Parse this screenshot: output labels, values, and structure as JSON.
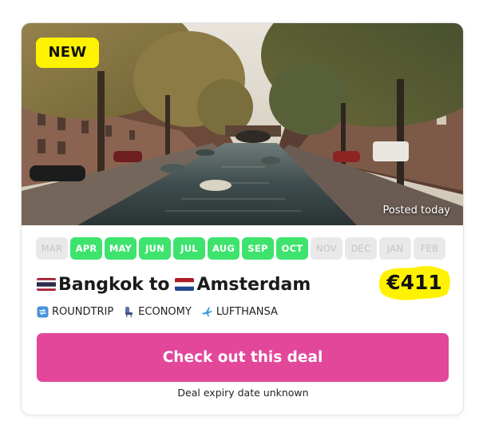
{
  "deal": {
    "badge": "NEW",
    "posted": "Posted today",
    "months": [
      {
        "label": "MAR",
        "active": false
      },
      {
        "label": "APR",
        "active": true
      },
      {
        "label": "MAY",
        "active": true
      },
      {
        "label": "JUN",
        "active": true
      },
      {
        "label": "JUL",
        "active": true
      },
      {
        "label": "AUG",
        "active": true
      },
      {
        "label": "SEP",
        "active": true
      },
      {
        "label": "OCT",
        "active": true
      },
      {
        "label": "NOV",
        "active": false
      },
      {
        "label": "DEC",
        "active": false
      },
      {
        "label": "JAN",
        "active": false
      },
      {
        "label": "FEB",
        "active": false
      }
    ],
    "origin": "Bangkok",
    "connector": "to",
    "destination": "Amsterdam",
    "origin_flag": "thailand-flag",
    "destination_flag": "netherlands-flag",
    "price": "€411",
    "tags": {
      "trip_type": "ROUNDTRIP",
      "cabin": "ECONOMY",
      "airline": "LUFTHANSA"
    },
    "cta_label": "Check out this deal",
    "expiry": "Deal expiry date unknown"
  },
  "colors": {
    "badge_bg": "#fff200",
    "month_active": "#3ee36d",
    "month_inactive": "#e9e9e9",
    "price_highlight": "#fff200",
    "cta_bg": "#e2479a"
  }
}
